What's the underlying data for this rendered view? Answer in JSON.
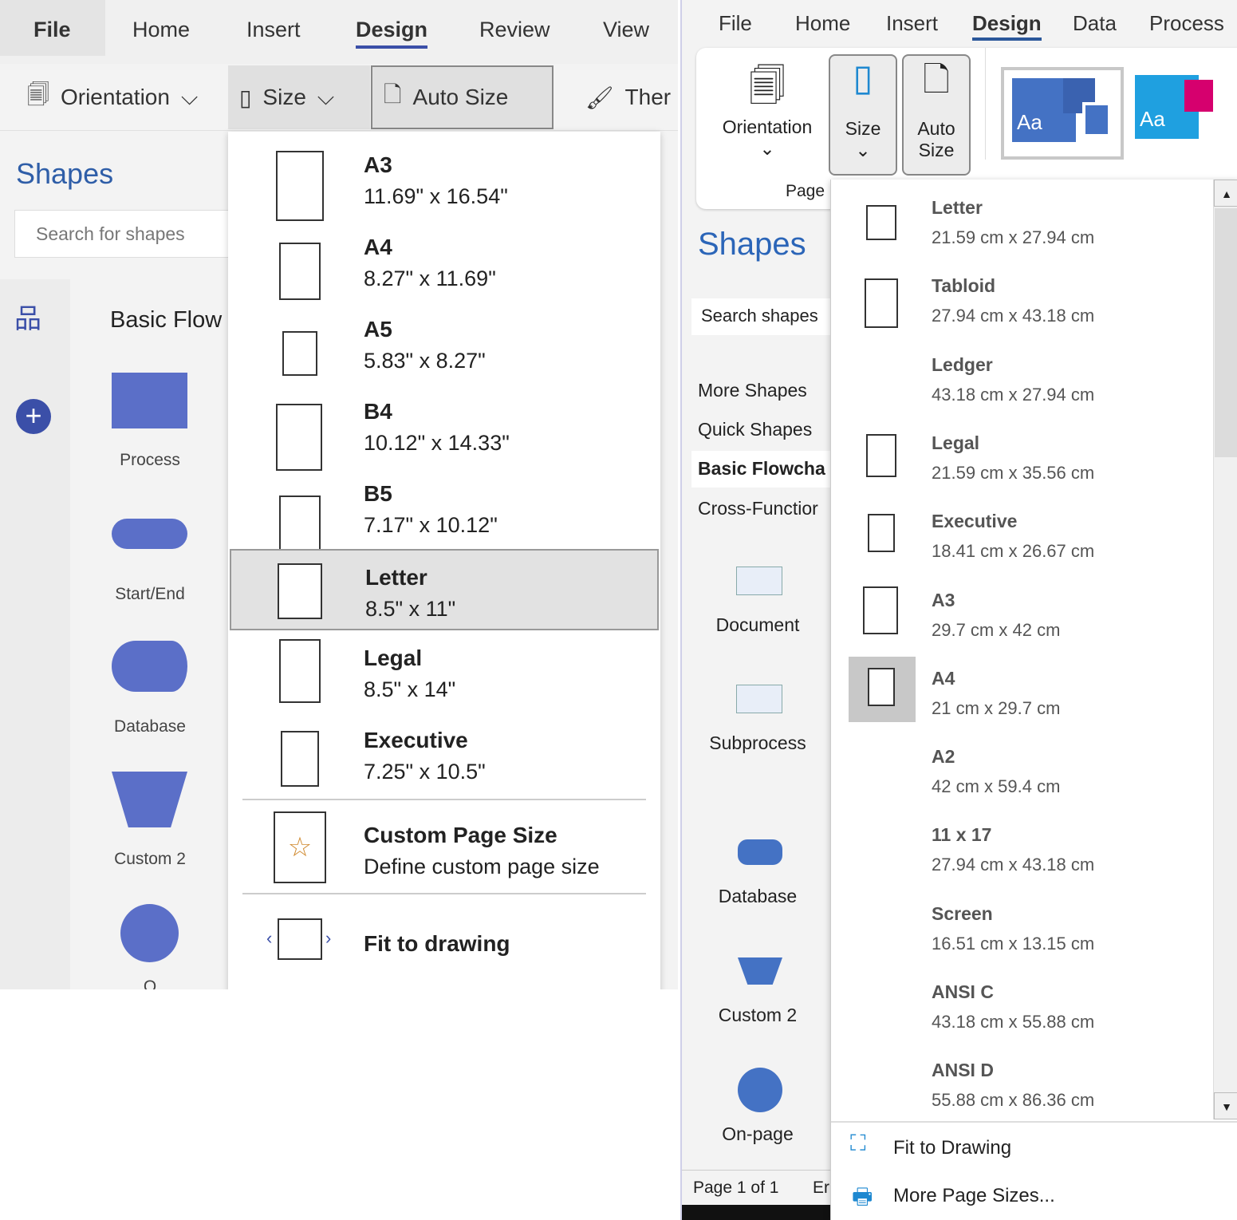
{
  "left": {
    "tabs": [
      "File",
      "Home",
      "Insert",
      "Design",
      "Review",
      "View"
    ],
    "active_tab": "Design",
    "ribbon": {
      "orientation": "Orientation",
      "size": "Size",
      "auto_size": "Auto Size",
      "themes": "Ther"
    },
    "shapes_title": "Shapes",
    "search_placeholder": "Search for shapes",
    "stencil": "Basic Flow",
    "shapes": [
      "Process",
      "Start/End",
      "Database",
      "Custom 2",
      "O"
    ],
    "size_menu": [
      {
        "name": "A3",
        "dims": "11.69\" x 16.54\""
      },
      {
        "name": "A4",
        "dims": "8.27\" x 11.69\""
      },
      {
        "name": "A5",
        "dims": "5.83\" x 8.27\""
      },
      {
        "name": "B4",
        "dims": "10.12\" x 14.33\""
      },
      {
        "name": "B5",
        "dims": "7.17\" x 10.12\""
      },
      {
        "name": "Letter",
        "dims": "8.5\" x 11\"",
        "selected": true
      },
      {
        "name": "Legal",
        "dims": "8.5\" x 14\""
      },
      {
        "name": "Executive",
        "dims": "7.25\" x 10.5\""
      }
    ],
    "custom": {
      "name": "Custom Page Size",
      "desc": "Define custom page size"
    },
    "fit": "Fit to drawing"
  },
  "right": {
    "tabs": [
      "File",
      "Home",
      "Insert",
      "Design",
      "Data",
      "Process"
    ],
    "active_tab": "Design",
    "ribbon": {
      "orientation": "Orientation",
      "size": "Size",
      "auto_size_1": "Auto",
      "auto_size_2": "Size",
      "group": "Page",
      "theme_text": "Aa"
    },
    "shapes_title": "Shapes",
    "search_placeholder": "Search shapes",
    "nav": [
      "More Shapes",
      "Quick Shapes",
      "Basic Flowcha",
      "Cross-Functior"
    ],
    "shapes": [
      "Document",
      "Subprocess",
      "Database",
      "Custom 2",
      "On-page"
    ],
    "status": {
      "page": "Page 1 of 1",
      "lang": "Er"
    },
    "size_menu": [
      {
        "name": "Letter",
        "dims": "21.59 cm x 27.94 cm"
      },
      {
        "name": "Tabloid",
        "dims": "27.94 cm x 43.18 cm"
      },
      {
        "name": "Ledger",
        "dims": "43.18 cm x 27.94 cm"
      },
      {
        "name": "Legal",
        "dims": "21.59 cm x 35.56 cm"
      },
      {
        "name": "Executive",
        "dims": "18.41 cm x 26.67 cm"
      },
      {
        "name": "A3",
        "dims": "29.7 cm x 42 cm"
      },
      {
        "name": "A4",
        "dims": "21 cm x 29.7 cm",
        "selected": true
      },
      {
        "name": "A2",
        "dims": "42 cm x 59.4 cm"
      },
      {
        "name": "11 x 17",
        "dims": "27.94 cm x 43.18 cm"
      },
      {
        "name": "Screen",
        "dims": "16.51 cm x 13.15 cm"
      },
      {
        "name": "ANSI C",
        "dims": "43.18 cm x 55.88 cm"
      },
      {
        "name": "ANSI D",
        "dims": "55.88 cm x 86.36 cm"
      }
    ],
    "fit": "Fit to Drawing",
    "more": "More Page Sizes..."
  },
  "colors": {
    "accent": "#2b579a",
    "shape": "#5b6fc8",
    "shapes_title": "#2f5ea8"
  }
}
